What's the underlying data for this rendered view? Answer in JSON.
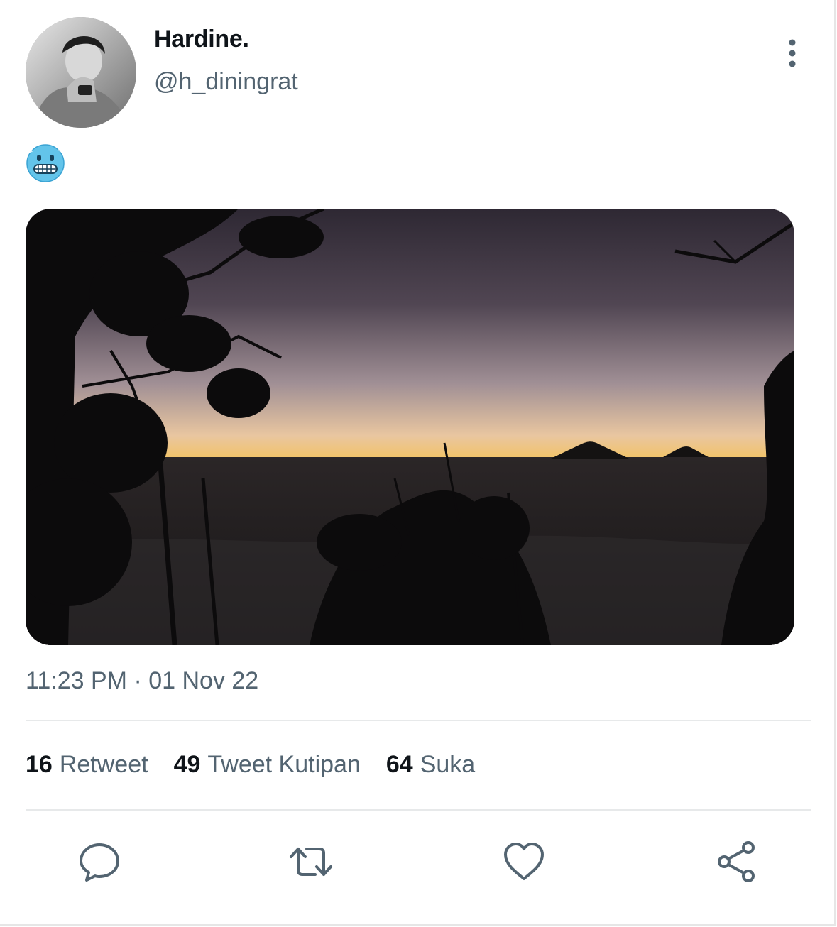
{
  "author": {
    "display_name": "Hardine.",
    "handle": "@h_diningrat"
  },
  "tweet": {
    "emoji": "cold-face-emoji",
    "timestamp": "11:23 PM · 01 Nov 22"
  },
  "stats": [
    {
      "count": "16",
      "label": "Retweet"
    },
    {
      "count": "49",
      "label": "Tweet Kutipan"
    },
    {
      "count": "64",
      "label": "Suka"
    }
  ],
  "actions": [
    {
      "icon": "reply-icon"
    },
    {
      "icon": "retweet-icon"
    },
    {
      "icon": "like-icon"
    },
    {
      "icon": "share-icon"
    }
  ],
  "colors": {
    "text_primary": "#0f1419",
    "text_secondary": "#536471",
    "divider": "#e7e9ea",
    "icon": "#536471"
  }
}
